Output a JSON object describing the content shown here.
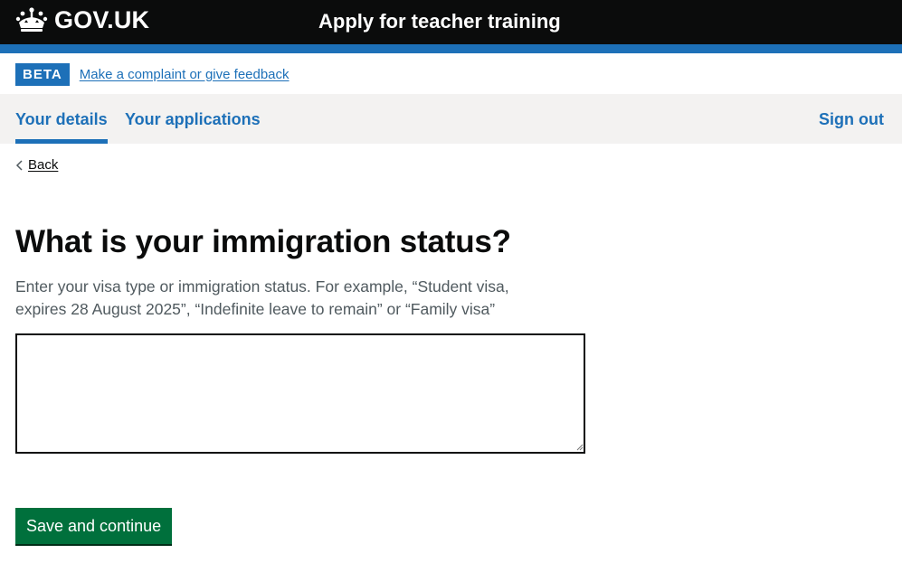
{
  "header": {
    "logo_text": "GOV.UK",
    "logo_icon": "crown-icon",
    "service_name": "Apply for teacher training"
  },
  "phase_banner": {
    "tag": "BETA",
    "link": "Make a complaint or give feedback"
  },
  "nav": {
    "items": [
      {
        "label": "Your details",
        "active": true
      },
      {
        "label": "Your applications",
        "active": false
      }
    ],
    "sign_out": "Sign out"
  },
  "back_link": {
    "label": "Back",
    "icon": "chevron-left-icon"
  },
  "form": {
    "heading": "What is your immigration status?",
    "hint": "Enter your visa type or immigration status. For example, “Student visa, expires 28 August 2025”, “Indefinite leave to remain” or “Family visa”",
    "textarea_value": "",
    "submit_label": "Save and continue"
  },
  "colors": {
    "header_bg": "#0b0c0c",
    "brand_blue": "#1d70b8",
    "nav_bg": "#f3f2f1",
    "button_green": "#00703c",
    "hint_grey": "#505a5f"
  }
}
